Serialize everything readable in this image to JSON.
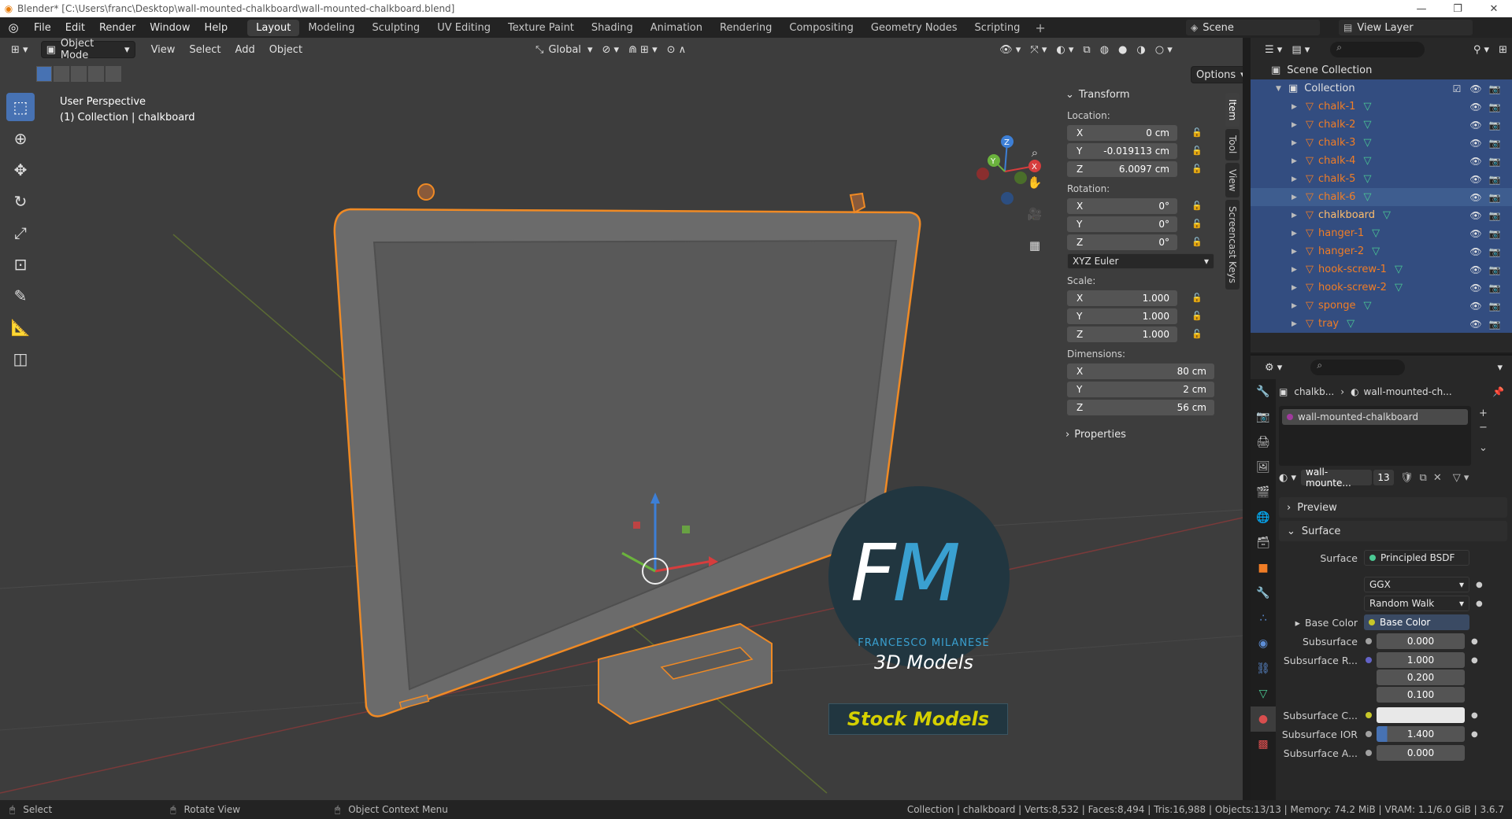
{
  "titlebar": {
    "title": "Blender* [C:\\Users\\franc\\Desktop\\wall-mounted-chalkboard\\wall-mounted-chalkboard.blend]"
  },
  "menu": [
    "File",
    "Edit",
    "Render",
    "Window",
    "Help"
  ],
  "workspaces": [
    "Layout",
    "Modeling",
    "Sculpting",
    "UV Editing",
    "Texture Paint",
    "Shading",
    "Animation",
    "Rendering",
    "Compositing",
    "Geometry Nodes",
    "Scripting"
  ],
  "active_workspace": "Layout",
  "scene": "Scene",
  "view_layer": "View Layer",
  "viewport": {
    "mode": "Object Mode",
    "menus": [
      "View",
      "Select",
      "Add",
      "Object"
    ],
    "orientation": "Global",
    "options_label": "Options",
    "perspective": "User Perspective",
    "context": "(1) Collection | chalkboard"
  },
  "transform": {
    "title": "Transform",
    "location_label": "Location:",
    "location": [
      {
        "axis": "X",
        "value": "0 cm"
      },
      {
        "axis": "Y",
        "value": "-0.019113 cm"
      },
      {
        "axis": "Z",
        "value": "6.0097 cm"
      }
    ],
    "rotation_label": "Rotation:",
    "rotation": [
      {
        "axis": "X",
        "value": "0°"
      },
      {
        "axis": "Y",
        "value": "0°"
      },
      {
        "axis": "Z",
        "value": "0°"
      }
    ],
    "rotation_mode": "XYZ Euler",
    "scale_label": "Scale:",
    "scale": [
      {
        "axis": "X",
        "value": "1.000"
      },
      {
        "axis": "Y",
        "value": "1.000"
      },
      {
        "axis": "Z",
        "value": "1.000"
      }
    ],
    "dimensions_label": "Dimensions:",
    "dimensions": [
      {
        "axis": "X",
        "value": "80 cm"
      },
      {
        "axis": "Y",
        "value": "2 cm"
      },
      {
        "axis": "Z",
        "value": "56 cm"
      }
    ],
    "properties_label": "Properties"
  },
  "side_tabs": [
    "Item",
    "Tool",
    "View",
    "Screencast Keys"
  ],
  "watermark": {
    "f": "F",
    "m": "M",
    "name": "FRANCESCO MILANESE",
    "subtitle": "3D Models",
    "stock": "Stock Models"
  },
  "outliner": {
    "scene_collection": "Scene Collection",
    "collection": "Collection",
    "objects": [
      "chalk-1",
      "chalk-2",
      "chalk-3",
      "chalk-4",
      "chalk-5",
      "chalk-6",
      "chalkboard",
      "hanger-1",
      "hanger-2",
      "hook-screw-1",
      "hook-screw-2",
      "sponge",
      "tray"
    ]
  },
  "properties": {
    "breadcrumb_obj": "chalkb...",
    "breadcrumb_mat": "wall-mounted-ch...",
    "material_slot": "wall-mounted-chalkboard",
    "material_name": "wall-mounte...",
    "users": "13",
    "preview": "Preview",
    "surface_section": "Surface",
    "surface_label": "Surface",
    "surface_value": "Principled BSDF",
    "distribution": "GGX",
    "subsurface_method": "Random Walk",
    "base_color_label": "Base Color",
    "base_color_value": "Base Color",
    "subsurface_label": "Subsurface",
    "subsurface_value": "0.000",
    "subsurface_radius_label": "Subsurface R...",
    "subsurface_radius": [
      "1.000",
      "0.200",
      "0.100"
    ],
    "subsurface_color_label": "Subsurface C...",
    "subsurface_ior_label": "Subsurface IOR",
    "subsurface_ior_value": "1.400",
    "subsurface_aniso_label": "Subsurface A...",
    "subsurface_aniso_value": "0.000"
  },
  "statusbar": {
    "select": "Select",
    "rotate": "Rotate View",
    "context_menu": "Object Context Menu",
    "stats": "Collection | chalkboard | Verts:8,532 | Faces:8,494 | Tris:16,988 | Objects:13/13 | Memory: 74.2 MiB | VRAM: 1.1/6.0 GiB | 3.6.7"
  },
  "colors": {
    "accent": "#4772b3",
    "selection_orange": "#f07d26",
    "mesh_green": "#4bc994"
  }
}
